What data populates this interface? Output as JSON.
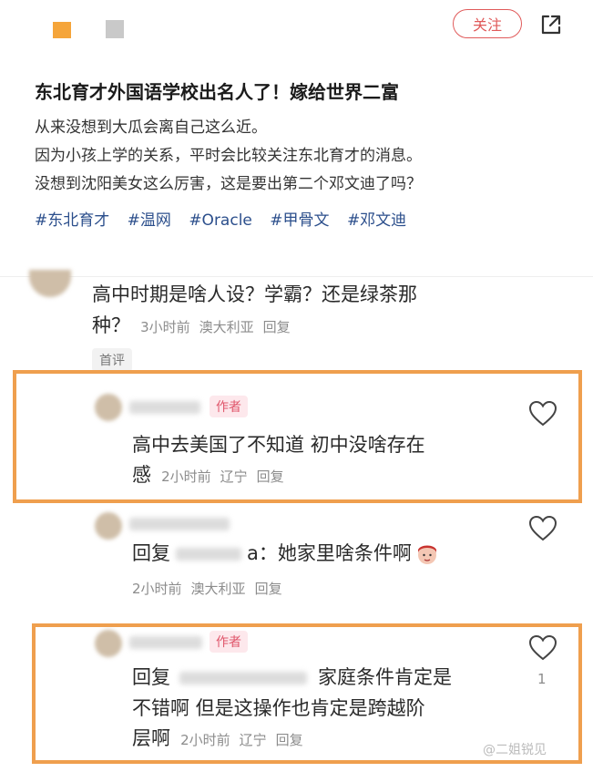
{
  "header": {
    "follow_label": "关注"
  },
  "post": {
    "title": "东北育才外国语学校出名人了！嫁给世界二富",
    "lines": [
      "从来没想到大瓜会离自己这么近。",
      "因为小孩上学的关系，平时会比较关注东北育才的消息。",
      "没想到沈阳美女这么厉害，这是要出第二个邓文迪了吗？"
    ],
    "tags": [
      "#东北育才",
      "#温网",
      "#Oracle",
      "#甲骨文",
      "#邓文迪"
    ]
  },
  "comments": {
    "top": {
      "text_line1": "高中时期是啥人设？学霸？还是绿茶那",
      "text_line2": "种？",
      "time": "3小时前",
      "location": "澳大利亚",
      "reply": "回复",
      "badge": "首评"
    },
    "reply1": {
      "author_tag": "作者",
      "text_line1": "高中去美国了不知道 初中没啥存在",
      "text_line2": "感",
      "time": "2小时前",
      "location": "辽宁",
      "reply": "回复"
    },
    "reply2": {
      "reply_prefix": "回复",
      "text_suffix": "a：她家里啥条件啊",
      "time": "2小时前",
      "location": "澳大利亚",
      "reply": "回复"
    },
    "reply3": {
      "author_tag": "作者",
      "reply_prefix": "回复",
      "text_line1_end": "家庭条件肯定是",
      "text_line2": "不错啊 但是这操作也肯定是跨越阶",
      "text_line3": "层啊",
      "time": "2小时前",
      "location": "辽宁",
      "reply": "回复",
      "like_count": "1"
    }
  },
  "watermark": "@二姐锐见",
  "colors": {
    "accent": "#e05a5a",
    "tag_link": "#2c4f8c",
    "highlight": "#ef9f4e"
  }
}
